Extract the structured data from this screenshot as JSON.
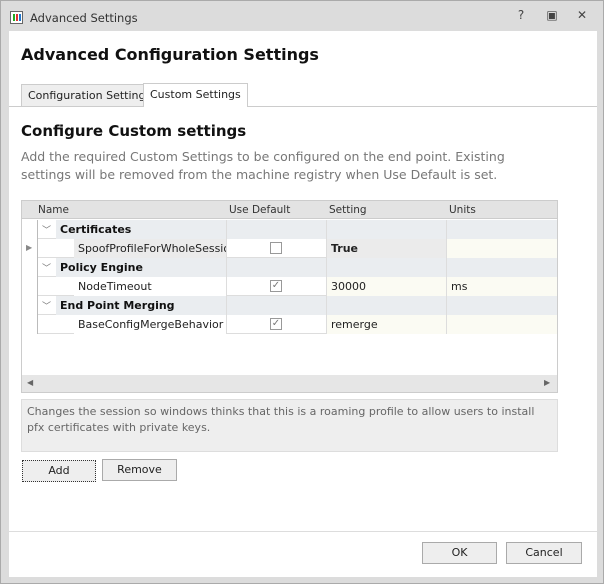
{
  "window": {
    "title": "Advanced Settings",
    "help_icon": "help-icon",
    "maximize_icon": "maximize-icon",
    "close_icon": "close-icon"
  },
  "heading": "Advanced Configuration Settings",
  "tabs": [
    {
      "label": "Configuration Settings",
      "active": false
    },
    {
      "label": "Custom Settings",
      "active": true
    }
  ],
  "section": {
    "title": "Configure Custom settings",
    "description": "Add the required Custom Settings to be configured on the end point. Existing settings will be removed from the machine registry when Use Default is set."
  },
  "grid": {
    "columns": [
      "Name",
      "Use Default",
      "Setting",
      "Units"
    ],
    "groups": [
      {
        "name": "Certificates",
        "items": [
          {
            "name": "SpoofProfileForWholeSession",
            "use_default": false,
            "setting": "True",
            "units": ""
          }
        ]
      },
      {
        "name": "Policy Engine",
        "items": [
          {
            "name": "NodeTimeout",
            "use_default": true,
            "setting": "30000",
            "units": "ms"
          }
        ]
      },
      {
        "name": "End Point Merging",
        "items": [
          {
            "name": "BaseConfigMergeBehavior",
            "use_default": true,
            "setting": "remerge",
            "units": ""
          }
        ]
      }
    ]
  },
  "info_text": "Changes the session so windows thinks that this is a roaming profile to allow users to install pfx certificates with private keys.",
  "buttons": {
    "add": "Add",
    "remove": "Remove",
    "ok": "OK",
    "cancel": "Cancel"
  }
}
